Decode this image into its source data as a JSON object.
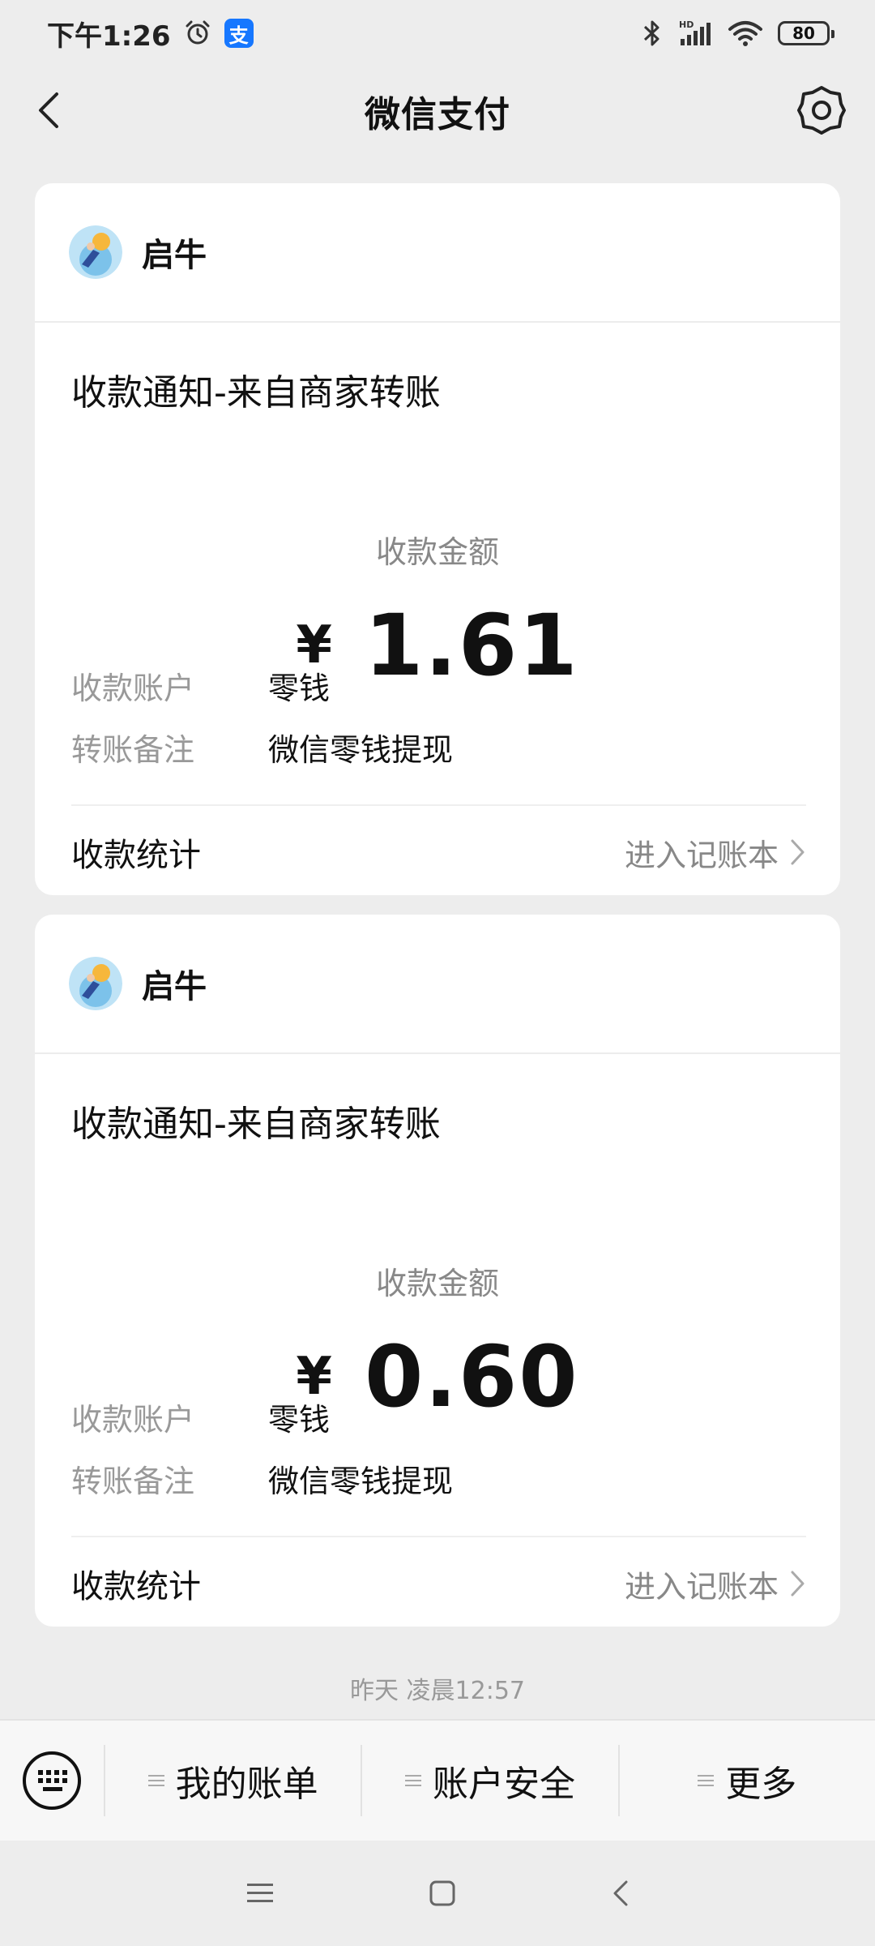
{
  "status_bar": {
    "time": "下午1:26",
    "alipay_glyph": "支",
    "battery": "80",
    "icons": [
      "alarm-icon",
      "alipay-icon",
      "bluetooth-icon",
      "hd-signal-icon",
      "wifi-icon",
      "battery-icon"
    ]
  },
  "nav": {
    "title": "微信支付",
    "back_icon": "back-icon",
    "settings_icon": "gear-icon"
  },
  "cards": [
    {
      "sender": "启牛",
      "title": "收款通知-来自商家转账",
      "amount_label": "收款金额",
      "currency": "¥",
      "amount": "1.61",
      "account_label": "收款账户",
      "account_value": "零钱",
      "remark_label": "转账备注",
      "remark_value": "微信零钱提现",
      "stats_label": "收款统计",
      "stats_link": "进入记账本"
    },
    {
      "sender": "启牛",
      "title": "收款通知-来自商家转账",
      "amount_label": "收款金额",
      "currency": "¥",
      "amount": "0.60",
      "account_label": "收款账户",
      "account_value": "零钱",
      "remark_label": "转账备注",
      "remark_value": "微信零钱提现",
      "stats_label": "收款统计",
      "stats_link": "进入记账本"
    }
  ],
  "timestamp": "昨天 凌晨12:57",
  "bottom_menu": {
    "items": [
      "我的账单",
      "账户安全",
      "更多"
    ]
  },
  "colors": {
    "background": "#ededed",
    "card": "#ffffff",
    "muted_text": "#888888",
    "alipay_blue": "#1677ff"
  }
}
